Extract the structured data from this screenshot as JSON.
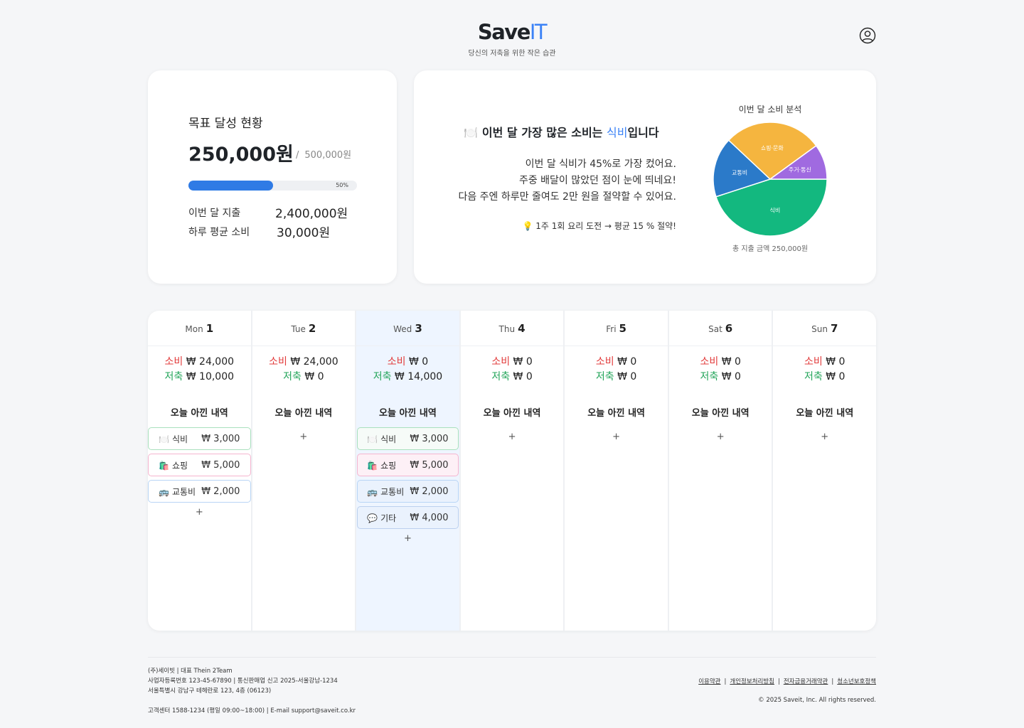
{
  "header": {
    "logo_main": "Save",
    "logo_accent": "IT",
    "tagline": "당신의 저축을 위한 작은 습관"
  },
  "goal": {
    "title": "목표 달성 현황",
    "current": "250,000원",
    "separator": "/",
    "target": "500,000원",
    "progress_label": "50%",
    "progress_value": 0.5,
    "month_spend_label": "이번 달 지출",
    "month_spend_value": "2,400,000원",
    "daily_avg_label": "하루 평균 소비",
    "daily_avg_value": "30,000원"
  },
  "analysis": {
    "plate_icon": "🍽️",
    "headline_prefix": "이번 달 가장 많은 소비는 ",
    "headline_category": "식비",
    "headline_suffix": "입니다",
    "desc_lines": [
      "이번 달 식비가 45%로 가장 컸어요.",
      "주중 배달이 많았던 점이 눈에 띄네요!",
      "다음 주엔 하루만 줄여도 2만 원을 절약할 수 있어요."
    ],
    "tip_icon": "💡",
    "tip": "1주 1회 요리 도전 → 평균 15 % 절약!",
    "pie_title": "이번 달 소비 분석",
    "pie_total": "총 지출 금액 250,000원"
  },
  "chart_data": {
    "type": "pie",
    "title": "이번 달 소비 분석",
    "slices": [
      {
        "label": "식비",
        "value": 45,
        "color": "#13b87f"
      },
      {
        "label": "교통비",
        "value": 17,
        "color": "#2b7ac9"
      },
      {
        "label": "쇼핑·문화",
        "value": 28,
        "color": "#f5b53f"
      },
      {
        "label": "주거·통신",
        "value": 10,
        "color": "#a06ae0"
      }
    ]
  },
  "calendar": {
    "spend_label": "소비",
    "save_label": "저축",
    "saved_title": "오늘 아낀 내역",
    "add_label": "+",
    "days": [
      {
        "name": "Mon",
        "num": "1",
        "spend": "₩ 24,000",
        "save": "₩ 10,000",
        "today": false,
        "items": [
          {
            "kind": "food",
            "icon": "🍽️",
            "label": "식비",
            "amount": "₩ 3,000"
          },
          {
            "kind": "shop",
            "icon": "🛍️",
            "label": "쇼핑",
            "amount": "₩ 5,000"
          },
          {
            "kind": "trans",
            "icon": "🚌",
            "label": "교통비",
            "amount": "₩ 2,000"
          }
        ]
      },
      {
        "name": "Tue",
        "num": "2",
        "spend": "₩ 24,000",
        "save": "₩ 0",
        "today": false,
        "items": []
      },
      {
        "name": "Wed",
        "num": "3",
        "spend": "₩ 0",
        "save": "₩ 14,000",
        "today": true,
        "items": [
          {
            "kind": "food",
            "icon": "🍽️",
            "label": "식비",
            "amount": "₩ 3,000"
          },
          {
            "kind": "shop",
            "icon": "🛍️",
            "label": "쇼핑",
            "amount": "₩ 5,000"
          },
          {
            "kind": "trans",
            "icon": "🚌",
            "label": "교통비",
            "amount": "₩ 2,000"
          },
          {
            "kind": "etc",
            "icon": "💬",
            "label": "기타",
            "amount": "₩ 4,000"
          }
        ]
      },
      {
        "name": "Thu",
        "num": "4",
        "spend": "₩ 0",
        "save": "₩ 0",
        "today": false,
        "items": []
      },
      {
        "name": "Fri",
        "num": "5",
        "spend": "₩ 0",
        "save": "₩ 0",
        "today": false,
        "items": []
      },
      {
        "name": "Sat",
        "num": "6",
        "spend": "₩ 0",
        "save": "₩ 0",
        "today": false,
        "items": []
      },
      {
        "name": "Sun",
        "num": "7",
        "spend": "₩ 0",
        "save": "₩ 0",
        "today": false,
        "items": []
      }
    ]
  },
  "footer": {
    "company": "(주)세이빗  |  대표 Thein 2Team",
    "business": "사업자등록번호 123-45-67890  |  통신판매업 신고 2025-서울강남-1234",
    "address": "서울특별시 강남구 테헤란로 123, 4층 (06123)",
    "customer_center": "고객센터 1588-1234 (평일 09:00~18:00)  |  E-mail support@saveit.co.kr",
    "links": [
      "이용약관",
      "개인정보처리방침",
      "전자금융거래약관",
      "청소년보호정책"
    ],
    "copyright": "© 2025 Saveit, Inc. All rights reserved."
  }
}
